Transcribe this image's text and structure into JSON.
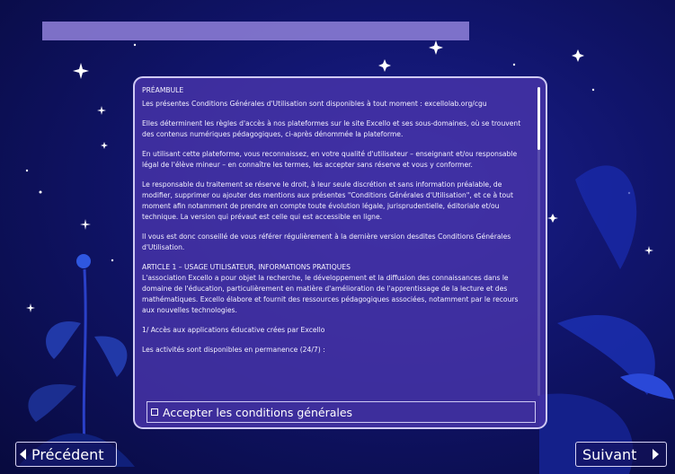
{
  "colors": {
    "background": "#10146a",
    "panel": "#4834aa",
    "title_bar": "#8a7bd4",
    "text": "#f4f2ff"
  },
  "content": {
    "heading": "PRÉAMBULE",
    "paragraphs": [
      "Les présentes Conditions Générales d'Utilisation sont disponibles à tout moment : excellolab.org/cgu",
      "Elles déterminent les règles d'accès à nos plateformes sur le site  Excello et ses sous-domaines, où se trouvent des contenus numériques pédagogiques, ci-après dénommée la plateforme.",
      "En utilisant cette plateforme, vous reconnaissez, en votre qualité d'utilisateur – enseignant et/ou responsable légal de l'élève mineur – en connaître les termes, les accepter sans réserve et vous y conformer.",
      "Le responsable du traitement se réserve le droit, à leur seule discrétion et sans information préalable, de modifier, supprimer ou ajouter des mentions aux présentes \"Conditions Générales d'Utilisation\", et ce à tout moment afin notamment de prendre en compte toute évolution légale, jurisprudentielle, éditoriale et/ou technique.  La version qui prévaut est celle qui est accessible en ligne.",
      "Il vous est donc conseillé de vous référer régulièrement à la dernière version desdites Conditions Générales d'Utilisation."
    ],
    "article_title": "ARTICLE 1 – USAGE UTILISATEUR, INFORMATIONS PRATIQUES",
    "article_text": "L'association  Excello a pour objet la recherche, le développement et la diffusion des connaissances dans le domaine de l'éducation, particulièrement en matière d'amélioration de l'apprentissage de la lecture et des mathématiques.  Excello élabore et fournit des ressources pédagogiques associées, notamment par le recours aux nouvelles technologies.",
    "section_1": "1/ Accès aux applications éducative crées par  Excello",
    "activities": "Les activités sont disponibles en permanence (24/7) :"
  },
  "accept_label": "Accepter les conditions générales",
  "nav": {
    "previous": "Précédent",
    "next": "Suivant"
  },
  "icons": {
    "prev": "triangle-left-icon",
    "next": "triangle-right-icon",
    "checkbox": "checkbox-icon"
  }
}
